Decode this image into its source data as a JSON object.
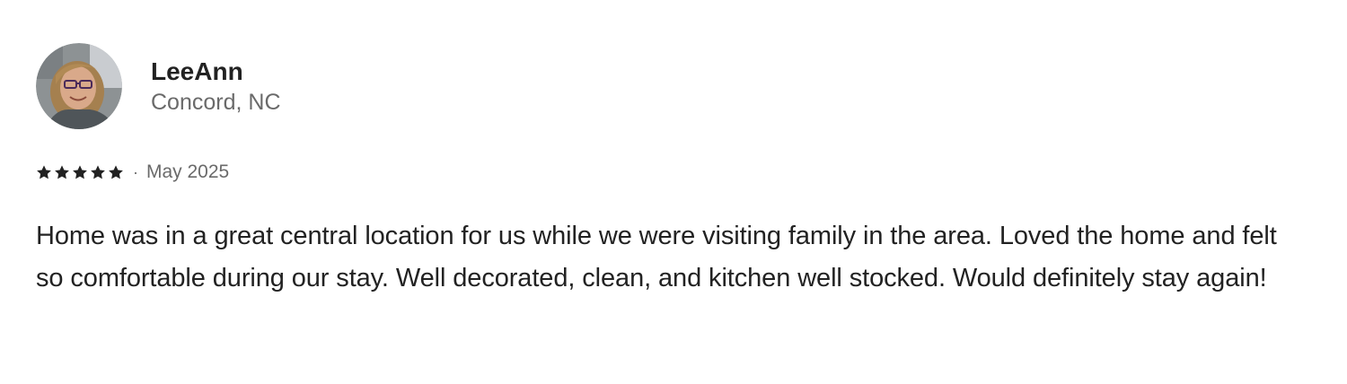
{
  "review": {
    "reviewer": {
      "name": "LeeAnn",
      "location": "Concord, NC",
      "avatar_icon": "user-photo-icon"
    },
    "rating": {
      "stars": 5,
      "max": 5,
      "star_icon": "star-icon",
      "star_color": "#222222"
    },
    "separator": "·",
    "date": "May 2025",
    "text": "Home was in a great central location for us while we were visiting family in the area. Loved the home and felt so comfortable during our stay. Well decorated, clean, and kitchen well stocked. Would definitely stay again!"
  },
  "colors": {
    "primary_text": "#222222",
    "secondary_text": "#6a6a6a",
    "background": "#ffffff"
  }
}
